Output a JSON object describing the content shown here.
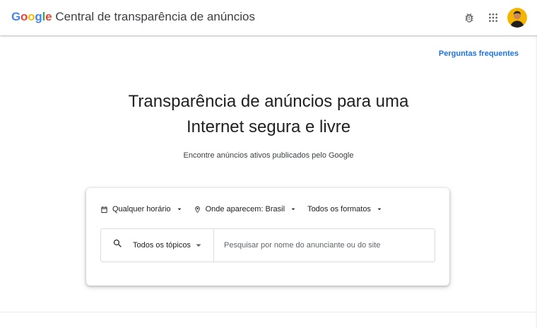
{
  "header": {
    "logo_letters": [
      {
        "char": "G",
        "color": "#4285F4"
      },
      {
        "char": "o",
        "color": "#EA4335"
      },
      {
        "char": "o",
        "color": "#FBBC05"
      },
      {
        "char": "g",
        "color": "#4285F4"
      },
      {
        "char": "l",
        "color": "#34A853"
      },
      {
        "char": "e",
        "color": "#EA4335"
      }
    ],
    "app_title": "Central de transparência de anúncios",
    "icons": [
      "bug-icon",
      "apps-grid-icon",
      "account-avatar"
    ]
  },
  "faq_link": "Perguntas frequentes",
  "hero": {
    "title_line1": "Transparência de anúncios para uma",
    "title_line2": "Internet segura e livre",
    "subtitle": "Encontre anúncios ativos publicados pelo Google"
  },
  "filters": {
    "time": "Qualquer horário",
    "location": "Onde aparecem: Brasil",
    "format": "Todos os formatos"
  },
  "search": {
    "topic_label": "Todos os tópicos",
    "placeholder": "Pesquisar por nome do anunciante ou do site",
    "value": ""
  },
  "colors": {
    "link": "#1a73e8",
    "text": "#202124",
    "border": "#dadce0"
  }
}
